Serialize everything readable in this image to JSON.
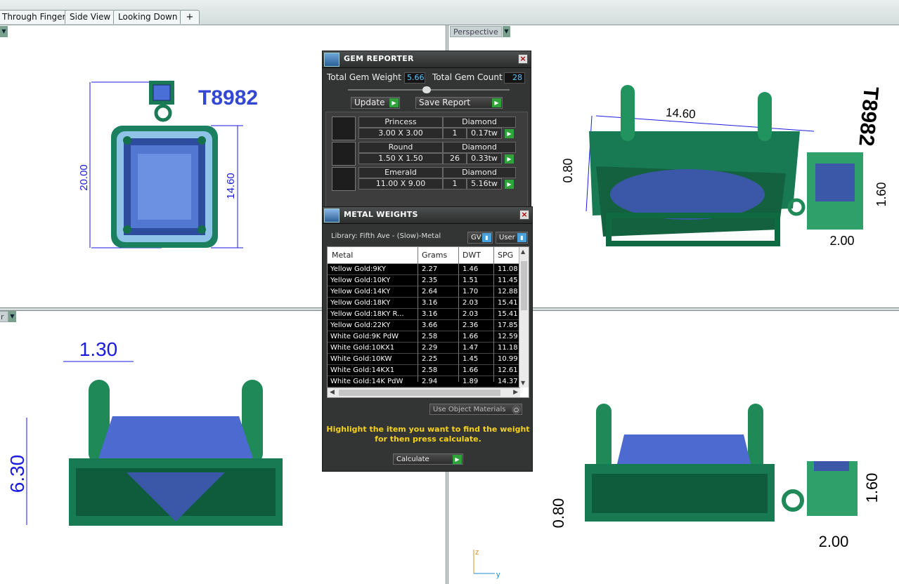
{
  "tabs": [
    {
      "label": "Through Finger"
    },
    {
      "label": "Side View"
    },
    {
      "label": "Looking Down"
    }
  ],
  "tab_add": "+",
  "viewports": {
    "perspective_label": "Perspective",
    "bottom_left_label": "r",
    "top_left": {
      "title_text": "T8982",
      "dim_height": "20.00",
      "dim_inner": "14.60"
    },
    "top_right": {
      "dim_width": "14.60",
      "dim_left": "0.80",
      "dim_right": "1.60",
      "dim_bottom": "2.00",
      "engraved_text": "T8982"
    },
    "bottom_left": {
      "dim_top": "1.30",
      "dim_height": "6.30"
    },
    "bottom_right": {
      "dim_left": "0.80",
      "dim_right": "1.60",
      "dim_bottom": "2.00"
    },
    "axis_z": "z",
    "axis_y": "y"
  },
  "gem_reporter": {
    "title": "GEM REPORTER",
    "close": "×",
    "total_weight_label": "Total Gem Weight",
    "total_weight_value": "5.66",
    "total_count_label": "Total Gem Count",
    "total_count_value": "28",
    "update_label": "Update",
    "save_report_label": "Save Report",
    "gems": [
      {
        "shape": "Princess",
        "size": "3.00 X 3.00",
        "material": "Diamond",
        "count": "1",
        "weight": "0.17tw"
      },
      {
        "shape": "Round",
        "size": "1.50 X 1.50",
        "material": "Diamond",
        "count": "26",
        "weight": "0.33tw"
      },
      {
        "shape": "Emerald",
        "size": "11.00 X 9.00",
        "material": "Diamond",
        "count": "1",
        "weight": "5.16tw"
      }
    ]
  },
  "metal_weights": {
    "title": "METAL WEIGHTS",
    "close": "×",
    "library_label": "Library: Fifth Ave - (Slow)-Metal",
    "gv_label": "GV",
    "user_label": "User",
    "columns": [
      "Metal",
      "Grams",
      "DWT",
      "SPG"
    ],
    "rows": [
      [
        "Yellow Gold:9KY",
        "2.27",
        "1.46",
        "11.08"
      ],
      [
        "Yellow Gold:10KY",
        "2.35",
        "1.51",
        "11.45"
      ],
      [
        "Yellow Gold:14KY",
        "2.64",
        "1.70",
        "12.88"
      ],
      [
        "Yellow Gold:18KY",
        "3.16",
        "2.03",
        "15.41"
      ],
      [
        "Yellow Gold:18KY R...",
        "3.16",
        "2.03",
        "15.41"
      ],
      [
        "Yellow Gold:22KY",
        "3.66",
        "2.36",
        "17.85"
      ],
      [
        "White Gold:9K PdW",
        "2.58",
        "1.66",
        "12.59"
      ],
      [
        "White Gold:10KX1",
        "2.29",
        "1.47",
        "11.18"
      ],
      [
        "White Gold:10KW",
        "2.25",
        "1.45",
        "10.99"
      ],
      [
        "White Gold:14KX1",
        "2.58",
        "1.66",
        "12.61"
      ],
      [
        "White Gold:14K PdW",
        "2.94",
        "1.89",
        "14.37"
      ]
    ],
    "use_object_materials": "Use Object Materials",
    "hint": "Highlight the item you want to find the weight for then press calculate.",
    "calculate_label": "Calculate"
  }
}
